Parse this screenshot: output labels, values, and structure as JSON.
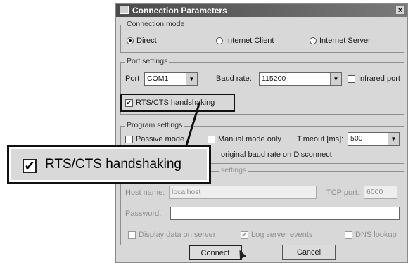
{
  "dialog": {
    "title": "Connection Parameters",
    "close_glyph": "×"
  },
  "connection_mode": {
    "title": "Connection mode",
    "options": [
      "Direct",
      "Internet Client",
      "Internet Server"
    ],
    "selected": "Direct"
  },
  "port_settings": {
    "title": "Port settings",
    "port_label": "Port",
    "port_value": "COM1",
    "baud_label": "Baud rate:",
    "baud_value": "115200",
    "infrared_label": "Infrared port",
    "infrared_checked": false,
    "rts_label": "RTS/CTS handshaking",
    "rts_checked": true
  },
  "program_settings": {
    "title": "Program settings",
    "passive_label": "Passive mode",
    "manual_label": "Manual mode only",
    "timeout_label": "Timeout [ms]:",
    "timeout_value": "500",
    "restore_label": "original baud rate on Disconnect"
  },
  "internet_settings": {
    "title": "settings",
    "host_label": "Host name:",
    "host_value": "localhost",
    "tcp_label": "TCP port:",
    "tcp_value": "6000",
    "password_label": "Password:",
    "password_value": "",
    "display_label": "Display data on server",
    "log_label": "Log server events",
    "log_checked": true,
    "dns_label": "DNS lookup"
  },
  "buttons": {
    "connect": "Connect",
    "cancel": "Cancel"
  },
  "callout": {
    "label": "RTS/CTS handshaking",
    "checked": true
  },
  "icons": {
    "check": "✔",
    "dropdown": "▼"
  }
}
